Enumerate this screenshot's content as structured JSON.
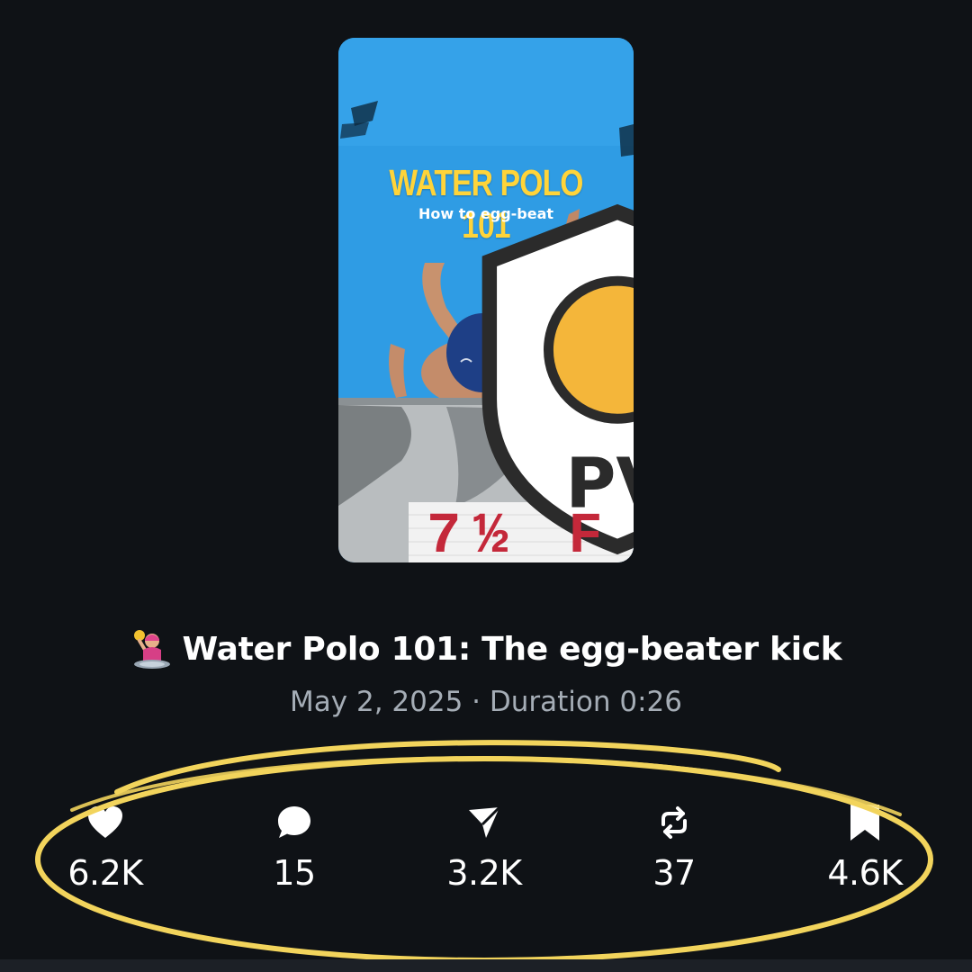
{
  "video": {
    "logo_text": "PV",
    "title_overlay": "WATER POLO 101",
    "subtitle_overlay": "How to egg-beat",
    "sign_text": "7½ F"
  },
  "caption": {
    "emoji": "person-playing-water-polo",
    "title": "Water Polo 101: The egg-beater kick",
    "meta": "May 2, 2025 · Duration 0:26"
  },
  "stats": {
    "likes": {
      "icon": "heart-icon",
      "value": "6.2K"
    },
    "comments": {
      "icon": "comment-icon",
      "value": "15"
    },
    "shares": {
      "icon": "send-icon",
      "value": "3.2K"
    },
    "reposts": {
      "icon": "repost-icon",
      "value": "37"
    },
    "saves": {
      "icon": "bookmark-icon",
      "value": "4.6K"
    }
  },
  "colors": {
    "background": "#0f1216",
    "annotation_ring": "#f2d45c",
    "overlay_title": "#ffd43a",
    "pool_water": "#2f9ce4",
    "meta_text": "#a5adb6"
  }
}
